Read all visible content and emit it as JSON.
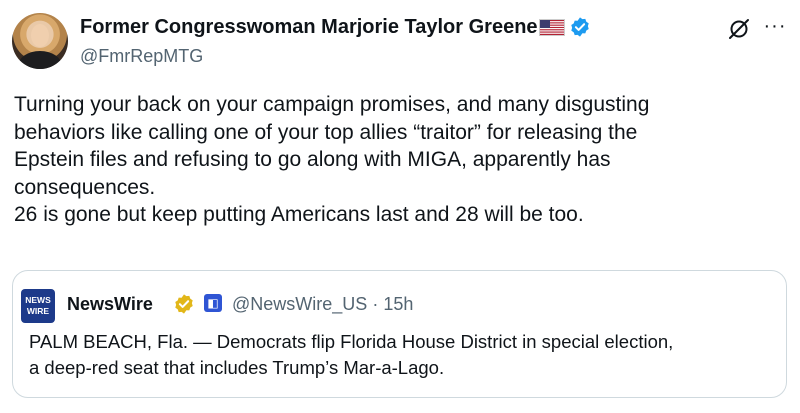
{
  "author": {
    "display_name": "Former Congresswoman Marjorie Taylor Greene",
    "handle": "@FmrRepMTG",
    "flag": "🇺🇸",
    "verified_color": "#1d9bf0"
  },
  "post": {
    "lines": [
      "Turning your back on your campaign promises, and many disgusting",
      "behaviors like calling one of your top allies “traitor” for releasing the",
      "Epstein files and refusing to go along with MIGA, apparently has",
      "consequences.",
      "26 is gone but keep putting Americans last and 28 will be too."
    ]
  },
  "actions": {
    "grok_icon": "grok-icon",
    "more_icon": "more-icon",
    "more_glyph": "···"
  },
  "quote": {
    "avatar_line1": "NEWS",
    "avatar_line2": "WIRE",
    "name": "NewsWire",
    "verified_color": "#e2b719",
    "affiliate_glyph": "◧",
    "handle": "@NewsWire_US",
    "separator": "·",
    "time": "15h",
    "lines": [
      "PALM BEACH, Fla. — Democrats flip Florida House District in special election,",
      "a deep-red seat that includes Trump’s Mar-a-Lago."
    ]
  }
}
